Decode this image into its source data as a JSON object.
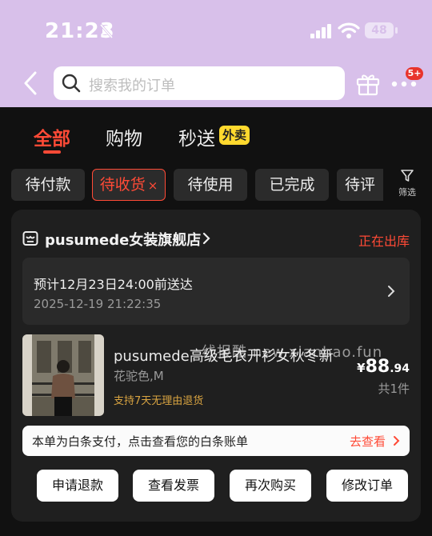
{
  "status_bar": {
    "time": "21:23",
    "battery": "48"
  },
  "search": {
    "placeholder": "搜索我的订单"
  },
  "notifications": {
    "badge": "5+"
  },
  "tabs": [
    {
      "label": "全部"
    },
    {
      "label": "购物"
    },
    {
      "label": "秒送",
      "tag": "外卖"
    }
  ],
  "filters": [
    "待付款",
    "待收货",
    "待使用",
    "已完成",
    "待评"
  ],
  "filter_selected_clear": "×",
  "filter_button_label": "筛选",
  "order": {
    "shop_name": "pusumede女装旗舰店",
    "status": "正在出库",
    "delivery_estimate": "预计12月23日24:00前送达",
    "order_time": "2025-12-19 21:22:35",
    "product_title": "pusumede高级毛衣开衫女秋冬新",
    "variant": "花驼色,M",
    "return_policy": "支持7天无理由退货",
    "price_symbol": "¥",
    "price_int": "88",
    "price_dec": ".94",
    "quantity": "共1件",
    "baitiao_notice": "本单为白条支付，点击查看您的白条账单",
    "baitiao_link": "去查看",
    "actions": [
      "申请退款",
      "查看发票",
      "再次购买",
      "修改订单"
    ]
  },
  "watermark": "线报酷 new.xianbao.fun",
  "colors": {
    "accent": "#ff4a36",
    "header_bg": "#d8c0ea",
    "waimai_tag": "#ffd92e"
  }
}
